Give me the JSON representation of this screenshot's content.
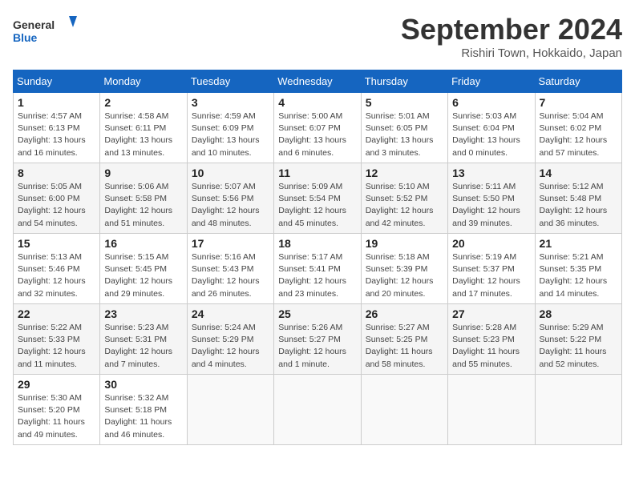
{
  "header": {
    "logo_line1": "General",
    "logo_line2": "Blue",
    "month": "September 2024",
    "location": "Rishiri Town, Hokkaido, Japan"
  },
  "days_of_week": [
    "Sunday",
    "Monday",
    "Tuesday",
    "Wednesday",
    "Thursday",
    "Friday",
    "Saturday"
  ],
  "weeks": [
    [
      {
        "day": "1",
        "info": "Sunrise: 4:57 AM\nSunset: 6:13 PM\nDaylight: 13 hours\nand 16 minutes."
      },
      {
        "day": "2",
        "info": "Sunrise: 4:58 AM\nSunset: 6:11 PM\nDaylight: 13 hours\nand 13 minutes."
      },
      {
        "day": "3",
        "info": "Sunrise: 4:59 AM\nSunset: 6:09 PM\nDaylight: 13 hours\nand 10 minutes."
      },
      {
        "day": "4",
        "info": "Sunrise: 5:00 AM\nSunset: 6:07 PM\nDaylight: 13 hours\nand 6 minutes."
      },
      {
        "day": "5",
        "info": "Sunrise: 5:01 AM\nSunset: 6:05 PM\nDaylight: 13 hours\nand 3 minutes."
      },
      {
        "day": "6",
        "info": "Sunrise: 5:03 AM\nSunset: 6:04 PM\nDaylight: 13 hours\nand 0 minutes."
      },
      {
        "day": "7",
        "info": "Sunrise: 5:04 AM\nSunset: 6:02 PM\nDaylight: 12 hours\nand 57 minutes."
      }
    ],
    [
      {
        "day": "8",
        "info": "Sunrise: 5:05 AM\nSunset: 6:00 PM\nDaylight: 12 hours\nand 54 minutes."
      },
      {
        "day": "9",
        "info": "Sunrise: 5:06 AM\nSunset: 5:58 PM\nDaylight: 12 hours\nand 51 minutes."
      },
      {
        "day": "10",
        "info": "Sunrise: 5:07 AM\nSunset: 5:56 PM\nDaylight: 12 hours\nand 48 minutes."
      },
      {
        "day": "11",
        "info": "Sunrise: 5:09 AM\nSunset: 5:54 PM\nDaylight: 12 hours\nand 45 minutes."
      },
      {
        "day": "12",
        "info": "Sunrise: 5:10 AM\nSunset: 5:52 PM\nDaylight: 12 hours\nand 42 minutes."
      },
      {
        "day": "13",
        "info": "Sunrise: 5:11 AM\nSunset: 5:50 PM\nDaylight: 12 hours\nand 39 minutes."
      },
      {
        "day": "14",
        "info": "Sunrise: 5:12 AM\nSunset: 5:48 PM\nDaylight: 12 hours\nand 36 minutes."
      }
    ],
    [
      {
        "day": "15",
        "info": "Sunrise: 5:13 AM\nSunset: 5:46 PM\nDaylight: 12 hours\nand 32 minutes."
      },
      {
        "day": "16",
        "info": "Sunrise: 5:15 AM\nSunset: 5:45 PM\nDaylight: 12 hours\nand 29 minutes."
      },
      {
        "day": "17",
        "info": "Sunrise: 5:16 AM\nSunset: 5:43 PM\nDaylight: 12 hours\nand 26 minutes."
      },
      {
        "day": "18",
        "info": "Sunrise: 5:17 AM\nSunset: 5:41 PM\nDaylight: 12 hours\nand 23 minutes."
      },
      {
        "day": "19",
        "info": "Sunrise: 5:18 AM\nSunset: 5:39 PM\nDaylight: 12 hours\nand 20 minutes."
      },
      {
        "day": "20",
        "info": "Sunrise: 5:19 AM\nSunset: 5:37 PM\nDaylight: 12 hours\nand 17 minutes."
      },
      {
        "day": "21",
        "info": "Sunrise: 5:21 AM\nSunset: 5:35 PM\nDaylight: 12 hours\nand 14 minutes."
      }
    ],
    [
      {
        "day": "22",
        "info": "Sunrise: 5:22 AM\nSunset: 5:33 PM\nDaylight: 12 hours\nand 11 minutes."
      },
      {
        "day": "23",
        "info": "Sunrise: 5:23 AM\nSunset: 5:31 PM\nDaylight: 12 hours\nand 7 minutes."
      },
      {
        "day": "24",
        "info": "Sunrise: 5:24 AM\nSunset: 5:29 PM\nDaylight: 12 hours\nand 4 minutes."
      },
      {
        "day": "25",
        "info": "Sunrise: 5:26 AM\nSunset: 5:27 PM\nDaylight: 12 hours\nand 1 minute."
      },
      {
        "day": "26",
        "info": "Sunrise: 5:27 AM\nSunset: 5:25 PM\nDaylight: 11 hours\nand 58 minutes."
      },
      {
        "day": "27",
        "info": "Sunrise: 5:28 AM\nSunset: 5:23 PM\nDaylight: 11 hours\nand 55 minutes."
      },
      {
        "day": "28",
        "info": "Sunrise: 5:29 AM\nSunset: 5:22 PM\nDaylight: 11 hours\nand 52 minutes."
      }
    ],
    [
      {
        "day": "29",
        "info": "Sunrise: 5:30 AM\nSunset: 5:20 PM\nDaylight: 11 hours\nand 49 minutes."
      },
      {
        "day": "30",
        "info": "Sunrise: 5:32 AM\nSunset: 5:18 PM\nDaylight: 11 hours\nand 46 minutes."
      },
      {
        "day": "",
        "info": ""
      },
      {
        "day": "",
        "info": ""
      },
      {
        "day": "",
        "info": ""
      },
      {
        "day": "",
        "info": ""
      },
      {
        "day": "",
        "info": ""
      }
    ]
  ]
}
